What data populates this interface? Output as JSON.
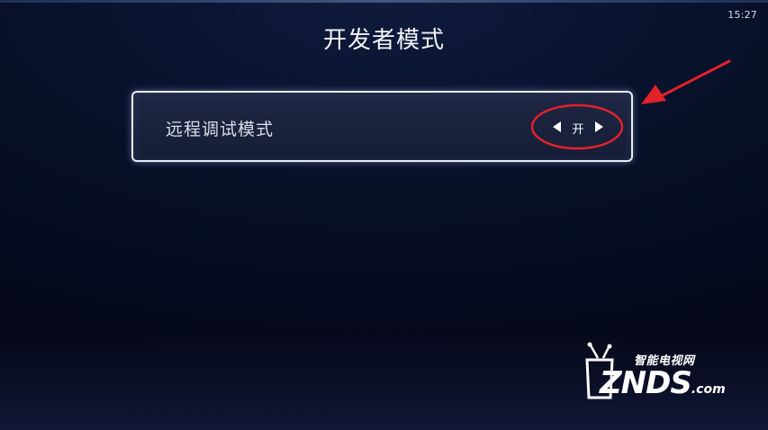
{
  "status_bar": {
    "time": "15:27"
  },
  "page": {
    "title": "开发者模式"
  },
  "settings": {
    "remote_debug": {
      "label": "远程调试模式",
      "value": "开",
      "left_arrow_icon": "triangle-left-icon",
      "right_arrow_icon": "triangle-right-icon"
    }
  },
  "annotation": {
    "color": "#e0222c"
  },
  "watermark": {
    "subtitle": "智能电视网",
    "brand": "ZNDS",
    "suffix": ".com"
  }
}
